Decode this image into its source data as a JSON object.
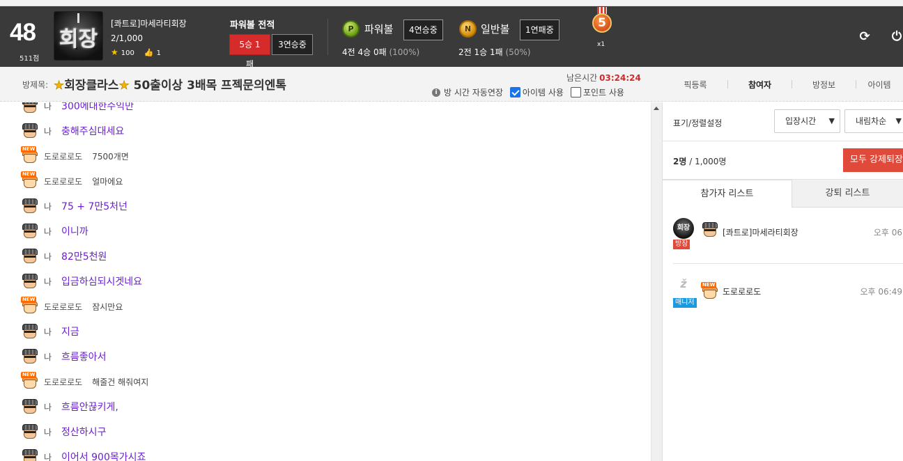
{
  "header": {
    "level": "48",
    "points": "511점",
    "logo_text": "회장",
    "user_name": "[콰트로]마세라티회장",
    "user_count": "2/1,000",
    "star_count": "100",
    "like_count": "1",
    "powerball_record_title": "파워볼 전적",
    "pb_badge_red": "5승 1패",
    "pb_badge_dark": "3연승중",
    "powerball": {
      "ball": "P",
      "label": "파워볼",
      "streak": "4연승중",
      "record": "4전 4승 0패",
      "pct": "(100%)"
    },
    "normalball": {
      "ball": "N",
      "label": "일반볼",
      "streak": "1연패중",
      "record": "2전 1승 1패",
      "pct": "(50%)"
    },
    "medal_number": "5",
    "medal_count": "x1",
    "icons": {
      "refresh": "refresh-icon",
      "power": "power-icon"
    }
  },
  "info_bar": {
    "room_label": "방제목:",
    "room_title": "회장클라스",
    "room_subtitle": "50출이상 3배목 프젝문의엔톡",
    "remain_label": "남은시간",
    "remain_time": "03:24:24",
    "auto_extend": "방 시간 자동연장",
    "item_use": "아이템 사용",
    "point_use": "포인트 사용",
    "item_checked": true,
    "point_checked": false,
    "tabs": [
      "픽등록",
      "참여자",
      "방정보",
      "아이템"
    ],
    "active_tab": "참여자"
  },
  "chat": {
    "messages": [
      {
        "type": "me",
        "nick": "나",
        "text": "300에대한수익만"
      },
      {
        "type": "me",
        "nick": "나",
        "text": "충해주심대세요"
      },
      {
        "type": "other",
        "nick": "도로로로도",
        "text": "7500개면"
      },
      {
        "type": "other",
        "nick": "도로로로도",
        "text": "얼마에요"
      },
      {
        "type": "me",
        "nick": "나",
        "text": "75 + 7만5처넌"
      },
      {
        "type": "me",
        "nick": "나",
        "text": "이니까"
      },
      {
        "type": "me",
        "nick": "나",
        "text": "82만5천원"
      },
      {
        "type": "me",
        "nick": "나",
        "text": "입금하심되시겟네요"
      },
      {
        "type": "other",
        "nick": "도로로로도",
        "text": "잠시만요"
      },
      {
        "type": "me",
        "nick": "나",
        "text": "지금"
      },
      {
        "type": "me",
        "nick": "나",
        "text": "흐름좋아서"
      },
      {
        "type": "other",
        "nick": "도로로로도",
        "text": "해줄건 해줘여지"
      },
      {
        "type": "me",
        "nick": "나",
        "text": "흐름안끊키게,"
      },
      {
        "type": "me",
        "nick": "나",
        "text": "정산하시구"
      },
      {
        "type": "me",
        "nick": "나",
        "text": "이어서 900목가시죠"
      }
    ]
  },
  "right_panel": {
    "sort_label": "표기/정렬설정",
    "sort_by": "입장시간",
    "sort_order": "내림차순",
    "count_current": "2명",
    "count_total": "/ 1,000명",
    "kick_all": "모두 강제퇴장",
    "tab_participants": "참가자 리스트",
    "tab_kicked": "강퇴 리스트",
    "members": [
      {
        "logo": "회장",
        "role": "방장",
        "name": "[콰트로]마세라티회장",
        "time": "오후 06"
      },
      {
        "logo": "",
        "role": "매니저",
        "name": "도로로로도",
        "time": "오후 06:49"
      }
    ]
  }
}
